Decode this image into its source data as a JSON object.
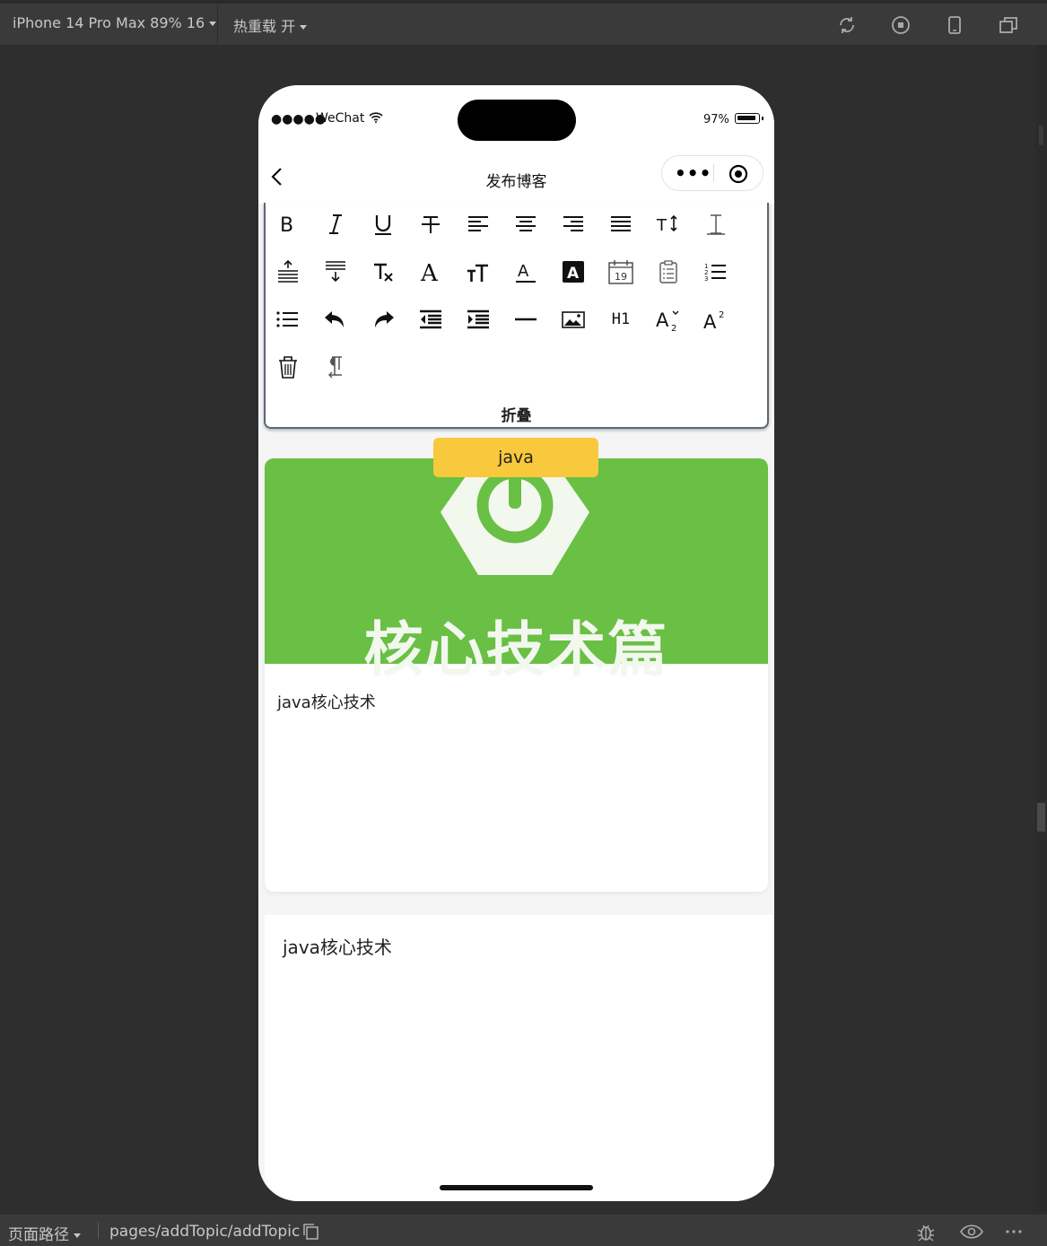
{
  "devtools": {
    "device": "iPhone 14 Pro Max 89% 16",
    "hot_reload": "热重载 开",
    "icons": [
      "compile-icon",
      "stop-icon",
      "phone-preview-icon",
      "window-icon"
    ]
  },
  "phone": {
    "status": {
      "signal": "●●●●●",
      "carrier": "WeChat",
      "battery": "97%"
    },
    "navbar": {
      "title": "发布博客",
      "more": "•••"
    },
    "toolbar": {
      "buttons": [
        "bold",
        "italic",
        "underline",
        "strikethrough",
        "align-left",
        "align-center",
        "align-right",
        "align-justify",
        "line-height",
        "letter-spacing",
        "margin-top",
        "margin-bottom",
        "clear-format",
        "font-family",
        "font-size",
        "font-color",
        "background-color",
        "date",
        "checklist",
        "ordered-list",
        "bullet-list",
        "undo",
        "redo",
        "outdent",
        "indent",
        "divider",
        "image",
        "H1",
        "subscript",
        "superscript",
        "clear",
        "direction"
      ],
      "h1_label": "H1",
      "fold_label": "折叠"
    },
    "card": {
      "cover_text": "核心技术篇",
      "title": "java核心技术",
      "tag": "java"
    },
    "editor": {
      "content": "java核心技术"
    }
  },
  "bottom": {
    "path_label": "页面路径",
    "path": "pages/addTopic/addTopic"
  },
  "colors": {
    "cover_green": "#6abf45",
    "tag_yellow": "#f8c93c",
    "toolbar_border": "#5b6875"
  }
}
